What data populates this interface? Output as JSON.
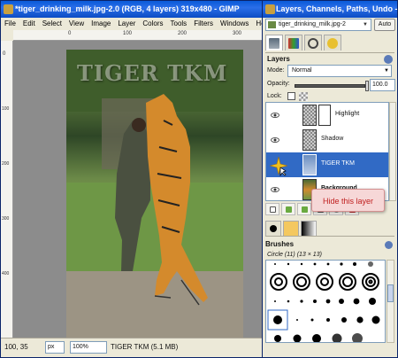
{
  "gimp": {
    "title": "*tiger_drinking_milk.jpg-2.0 (RGB, 4 layers) 319x480 - GIMP",
    "menu": [
      "File",
      "Edit",
      "Select",
      "View",
      "Image",
      "Layer",
      "Colors",
      "Tools",
      "Filters",
      "Windows",
      "Help"
    ],
    "ruler_top_ticks": [
      "0",
      "100",
      "200",
      "300"
    ],
    "ruler_left_ticks": [
      "0",
      "100",
      "200",
      "300",
      "400"
    ],
    "canvas_text": "TIGER TKM",
    "status": {
      "coords": "100, 35",
      "unit": "px",
      "zoom": "100%",
      "info": "TIGER TKM (5.1 MB)"
    }
  },
  "dock": {
    "title": "Layers, Channels, Paths, Undo - Brus...",
    "image_select": "tiger_drinking_milk.jpg-2",
    "auto_label": "Auto",
    "tab_icons": [
      "layers-tab-icon",
      "channels-tab-icon",
      "paths-tab-icon",
      "undo-tab-icon"
    ],
    "layers": {
      "header": "Layers",
      "mode_label": "Mode:",
      "mode_value": "Normal",
      "opacity_label": "Opacity:",
      "opacity_value": "100.0",
      "opacity_fraction": 1.0,
      "lock_label": "Lock:",
      "rows": [
        {
          "name": "Highlight",
          "visible": true,
          "selected": false,
          "bold": false
        },
        {
          "name": "Shadow",
          "visible": true,
          "selected": false,
          "bold": false
        },
        {
          "name": "TIGER TKM",
          "visible": false,
          "selected": true,
          "bold": false
        },
        {
          "name": "Background",
          "visible": true,
          "selected": false,
          "bold": true
        }
      ]
    },
    "tooltip": "Hide this layer",
    "brushes": {
      "header": "Brushes",
      "current": "Circle (11) (13 × 13)"
    }
  },
  "colors": {
    "titlebar": "#0c4cc4",
    "selection": "#316ac5",
    "tooltip_text": "#c02020",
    "tooltip_bg": "#f6d7d7"
  }
}
